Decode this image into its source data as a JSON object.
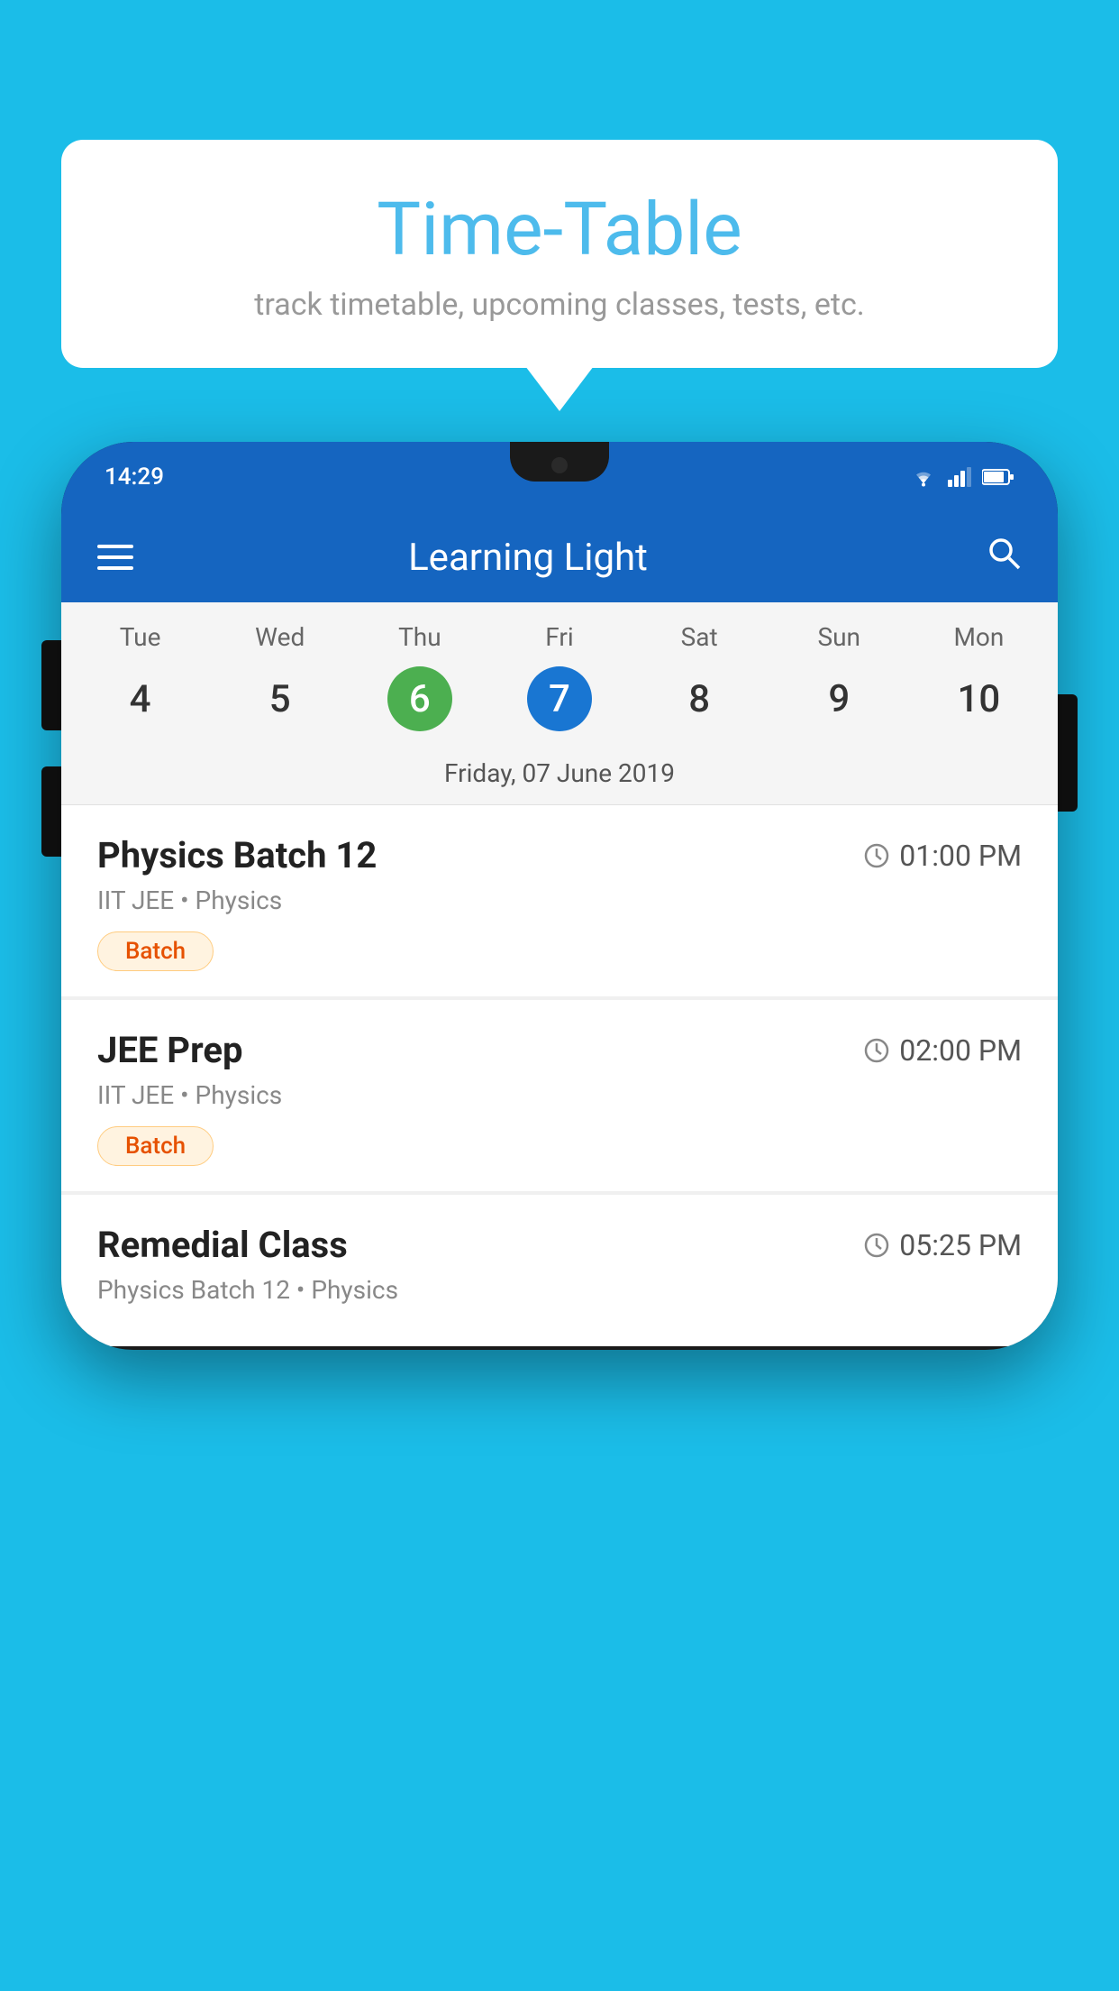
{
  "background_color": "#1BBDE8",
  "bubble": {
    "title": "Time-Table",
    "subtitle": "track timetable, upcoming classes, tests, etc."
  },
  "phone": {
    "status_bar": {
      "time": "14:29",
      "icons": [
        "wifi",
        "signal",
        "battery"
      ]
    },
    "app_bar": {
      "title": "Learning Light"
    },
    "calendar": {
      "days": [
        "Tue",
        "Wed",
        "Thu",
        "Fri",
        "Sat",
        "Sun",
        "Mon"
      ],
      "dates": [
        "4",
        "5",
        "6",
        "7",
        "8",
        "9",
        "10"
      ],
      "today_index": 2,
      "selected_index": 3,
      "selected_date_label": "Friday, 07 June 2019"
    },
    "classes": [
      {
        "name": "Physics Batch 12",
        "time": "01:00 PM",
        "meta": "IIT JEE • Physics",
        "badge": "Batch"
      },
      {
        "name": "JEE Prep",
        "time": "02:00 PM",
        "meta": "IIT JEE • Physics",
        "badge": "Batch"
      },
      {
        "name": "Remedial Class",
        "time": "05:25 PM",
        "meta": "Physics Batch 12 • Physics",
        "badge": ""
      }
    ]
  }
}
